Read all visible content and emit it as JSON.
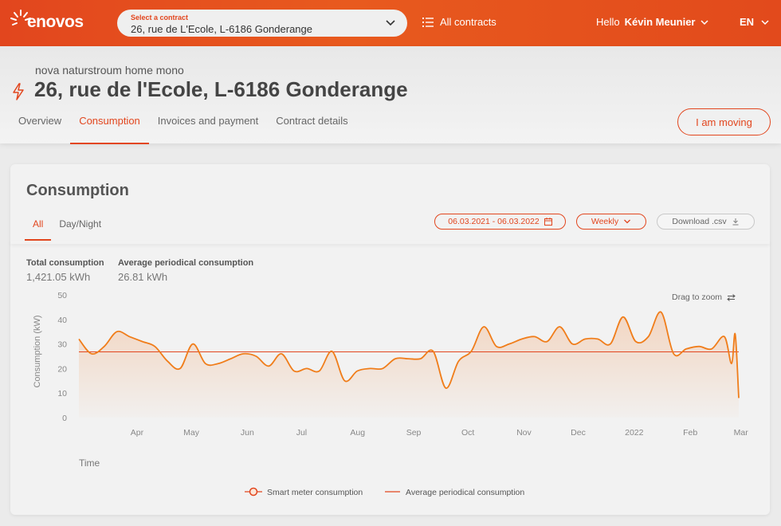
{
  "topbar": {
    "logo_text": "enovos",
    "contract_select_label": "Select a contract",
    "contract_select_value": "26, rue de L'Ecole, L-6186 Gonderange",
    "all_contracts": "All contracts",
    "hello": "Hello",
    "user_name": "Kévin Meunier",
    "language": "EN"
  },
  "header": {
    "product": "nova naturstroum home mono",
    "address": "26, rue de l'Ecole, L-6186 Gonderange",
    "tabs": [
      "Overview",
      "Consumption",
      "Invoices and payment",
      "Contract details"
    ],
    "active_tab": "Consumption",
    "moving_button": "I am moving"
  },
  "card": {
    "title": "Consumption",
    "subtabs": [
      "All",
      "Day/Night"
    ],
    "active_subtab": "All",
    "date_range": "06.03.2021 - 06.03.2022",
    "period": "Weekly",
    "download": "Download .csv",
    "total_label": "Total consumption",
    "total_value": "1,421.05 kWh",
    "avg_label": "Average periodical consumption",
    "avg_value": "26.81 kWh",
    "drag_to_zoom": "Drag to zoom"
  },
  "colors": {
    "brand": "#e2461e",
    "line": "#f07d1a"
  },
  "chart_data": {
    "type": "line",
    "ylabel": "Consumption (kW)",
    "xlabel": "Time",
    "ylim": [
      0,
      50
    ],
    "yticks": [
      0,
      10,
      20,
      30,
      40,
      50
    ],
    "x_ticks": [
      "Apr",
      "May",
      "Jun",
      "Jul",
      "Aug",
      "Sep",
      "Oct",
      "Nov",
      "Dec",
      "2022",
      "Feb",
      "Mar"
    ],
    "x_range": [
      "2021-03-06",
      "2022-03-06"
    ],
    "average": 26.8,
    "legend": [
      "Smart meter consumption",
      "Average periodical consumption"
    ],
    "series": [
      {
        "name": "Smart meter consumption",
        "points": [
          [
            "2021-03-06",
            32
          ],
          [
            "2021-03-13",
            26
          ],
          [
            "2021-03-20",
            29
          ],
          [
            "2021-03-27",
            35
          ],
          [
            "2021-04-03",
            33
          ],
          [
            "2021-04-10",
            31
          ],
          [
            "2021-04-17",
            29
          ],
          [
            "2021-04-24",
            23
          ],
          [
            "2021-05-01",
            20
          ],
          [
            "2021-05-08",
            30
          ],
          [
            "2021-05-15",
            22
          ],
          [
            "2021-05-22",
            22
          ],
          [
            "2021-05-29",
            24
          ],
          [
            "2021-06-05",
            26
          ],
          [
            "2021-06-12",
            25
          ],
          [
            "2021-06-19",
            21
          ],
          [
            "2021-06-26",
            26
          ],
          [
            "2021-07-03",
            19
          ],
          [
            "2021-07-10",
            20
          ],
          [
            "2021-07-17",
            19
          ],
          [
            "2021-07-24",
            27
          ],
          [
            "2021-07-31",
            15
          ],
          [
            "2021-08-07",
            19
          ],
          [
            "2021-08-14",
            20
          ],
          [
            "2021-08-21",
            20
          ],
          [
            "2021-08-28",
            24
          ],
          [
            "2021-09-04",
            24
          ],
          [
            "2021-09-11",
            24
          ],
          [
            "2021-09-18",
            27
          ],
          [
            "2021-09-25",
            12
          ],
          [
            "2021-10-02",
            23
          ],
          [
            "2021-10-09",
            27
          ],
          [
            "2021-10-16",
            37
          ],
          [
            "2021-10-23",
            29
          ],
          [
            "2021-10-30",
            30
          ],
          [
            "2021-11-06",
            32
          ],
          [
            "2021-11-13",
            33
          ],
          [
            "2021-11-20",
            31
          ],
          [
            "2021-11-27",
            37
          ],
          [
            "2021-12-04",
            30
          ],
          [
            "2021-12-11",
            32
          ],
          [
            "2021-12-18",
            32
          ],
          [
            "2021-12-25",
            30
          ],
          [
            "2022-01-01",
            41
          ],
          [
            "2022-01-08",
            31
          ],
          [
            "2022-01-15",
            33
          ],
          [
            "2022-01-22",
            43
          ],
          [
            "2022-01-29",
            26
          ],
          [
            "2022-02-05",
            28
          ],
          [
            "2022-02-12",
            29
          ],
          [
            "2022-02-19",
            28
          ],
          [
            "2022-02-26",
            33
          ],
          [
            "2022-03-02",
            22
          ],
          [
            "2022-03-04",
            34
          ],
          [
            "2022-03-06",
            8
          ]
        ]
      }
    ]
  }
}
